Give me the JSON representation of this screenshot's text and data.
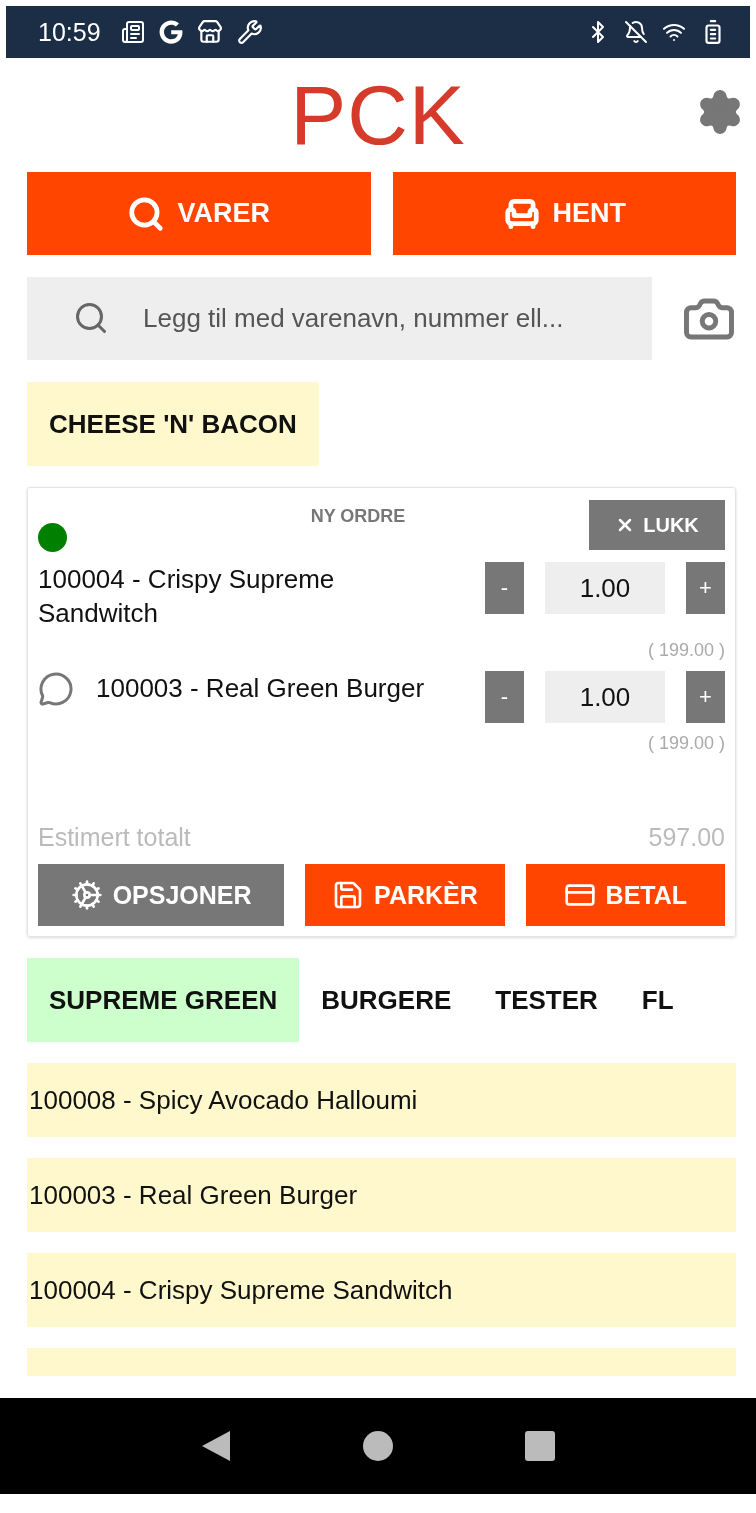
{
  "status_bar": {
    "time": "10:59"
  },
  "header": {
    "logo": "PCK"
  },
  "top_buttons": [
    {
      "kind": "search",
      "label": "VARER"
    },
    {
      "kind": "chair",
      "label": "HENT"
    }
  ],
  "search": {
    "placeholder": "Legg til med varenavn, nummer ell..."
  },
  "table_tag": {
    "label": "CHEESE 'N' BACON"
  },
  "order": {
    "online": true,
    "title": "NY ORDRE",
    "close_label": "LUKK",
    "lines": [
      {
        "name": "100004 - Crispy Supreme Sandwitch",
        "has_comment": false,
        "minus": "-",
        "quantity": "1.00",
        "plus": "+",
        "price": "( 199.00 )"
      },
      {
        "name": "100003 - Real Green Burger",
        "has_comment": true,
        "minus": "-",
        "quantity": "1.00",
        "plus": "+",
        "price": "( 199.00 )"
      }
    ],
    "total_label": "Estimert totalt",
    "total": "597.00",
    "actions": [
      {
        "kind": "options",
        "label": "OPSJONER"
      },
      {
        "kind": "park",
        "label": "PARKÈR"
      },
      {
        "kind": "pay",
        "label": "BETAL"
      }
    ]
  },
  "categories": [
    {
      "label": "SUPREME GREEN",
      "selected": true
    },
    {
      "label": "BURGERE",
      "selected": false
    },
    {
      "label": "TESTER",
      "selected": false
    },
    {
      "label": "FL",
      "selected": false
    }
  ],
  "products": [
    {
      "label": "100008 - Spicy Avocado Halloumi"
    },
    {
      "label": "100003 - Real Green Burger"
    },
    {
      "label": "100004 - Crispy Supreme Sandwitch"
    }
  ]
}
